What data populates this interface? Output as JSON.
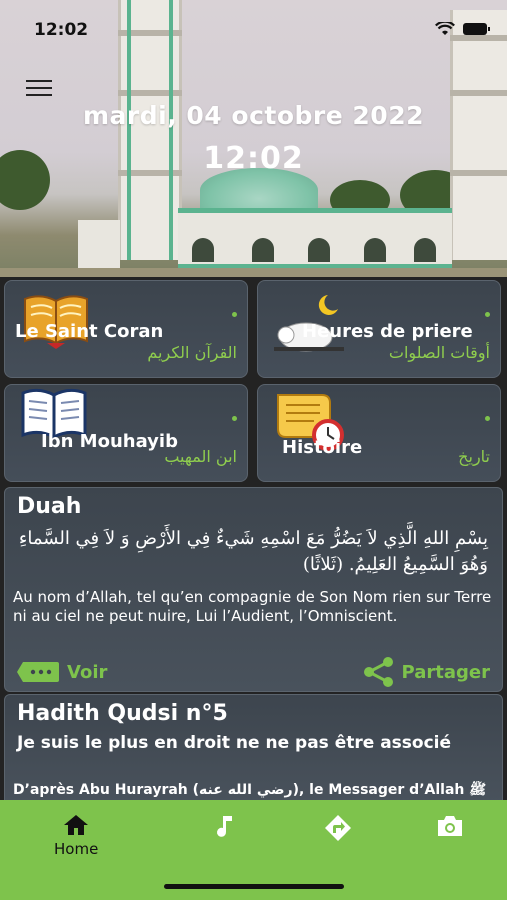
{
  "status": {
    "time": "12:02"
  },
  "header": {
    "date": "mardi, 04 octobre 2022",
    "clock": "12:02"
  },
  "tiles": [
    {
      "fr": "Le Saint Coran",
      "ar": "القرآن الكريم",
      "icon": "quran-book-icon"
    },
    {
      "fr": "Heures de priere",
      "ar": "أوقات الصلوات",
      "icon": "prayer-moon-icon"
    },
    {
      "fr": "Ibn Mouhayib",
      "ar": "ابن المهيب",
      "icon": "open-book-icon"
    },
    {
      "fr": "Histoire",
      "ar": "تاريخ",
      "icon": "scroll-clock-icon"
    }
  ],
  "duah": {
    "title": "Duah",
    "arabic": "بِسْمِ اللهِ الَّذِي لاَ يَضُرُّ مَعَ اسْمِهِ شَيءٌ فِي الأَرْضِ وَ لاَ فِي السَّماءِ وَهُوَ السَّمِيعُ العَلِيمُ. (ثَلاثًا)",
    "translation": "Au nom d’Allah, tel qu’en compagnie de Son Nom rien sur Terre ni au ciel ne peut nuire, Lui l’Audient, l’Omniscient.",
    "voir": "Voir",
    "partager": "Partager"
  },
  "hadith": {
    "title": "Hadith Qudsi n°5",
    "subtitle": "Je suis le plus en droit ne ne pas être associé",
    "line": "D’après Abu Hurayrah (رضي الله عنه), le Messager d’Allah ﷺ"
  },
  "tabs": [
    {
      "label": "Home",
      "icon": "home-icon"
    },
    {
      "icon": "music-icon"
    },
    {
      "icon": "directions-icon"
    },
    {
      "icon": "camera-icon"
    }
  ],
  "colors": {
    "accent": "#7ec34c",
    "card": "#434b55"
  }
}
